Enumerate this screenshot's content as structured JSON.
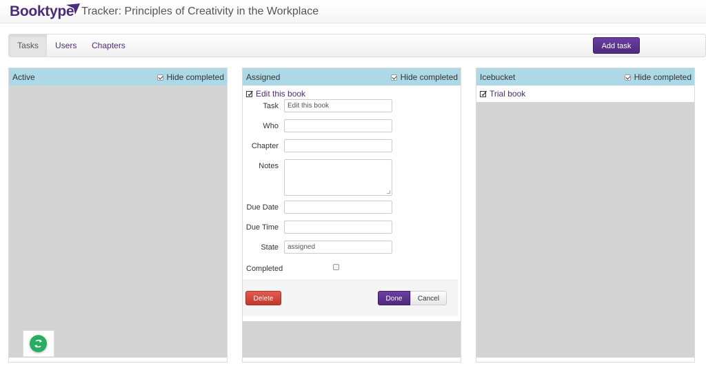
{
  "header": {
    "logo_text": "Booktype",
    "title": "Tracker: Principles of Creativity in the Workplace"
  },
  "nav": {
    "tabs": [
      {
        "label": "Tasks",
        "active": true
      },
      {
        "label": "Users",
        "active": false
      },
      {
        "label": "Chapters",
        "active": false
      }
    ],
    "add_task_label": "Add task"
  },
  "columns": [
    {
      "title": "Active",
      "hide_completed_label": "Hide completed",
      "hide_completed": true
    },
    {
      "title": "Assigned",
      "hide_completed_label": "Hide completed",
      "hide_completed": true
    },
    {
      "title": "Icebucket",
      "hide_completed_label": "Hide completed",
      "hide_completed": true
    }
  ],
  "assigned_task": {
    "link_label": "Edit this book",
    "form": {
      "task_label": "Task",
      "task_value": "Edit this book",
      "who_label": "Who",
      "who_value": "",
      "chapter_label": "Chapter",
      "chapter_value": "",
      "notes_label": "Notes",
      "notes_value": "",
      "due_date_label": "Due Date",
      "due_date_value": "",
      "due_time_label": "Due Time",
      "due_time_value": "",
      "state_label": "State",
      "state_value": "assigned",
      "completed_label": "Completed",
      "completed": false
    },
    "delete_label": "Delete",
    "done_label": "Done",
    "cancel_label": "Cancel"
  },
  "icebucket_task": {
    "link_label": "Trial book"
  },
  "colors": {
    "brand_purple": "#4b2c7c",
    "column_header": "#add8e6",
    "column_body": "#d3d3d3",
    "delete_red": "#c0392b",
    "widget_green": "#27ae60"
  }
}
